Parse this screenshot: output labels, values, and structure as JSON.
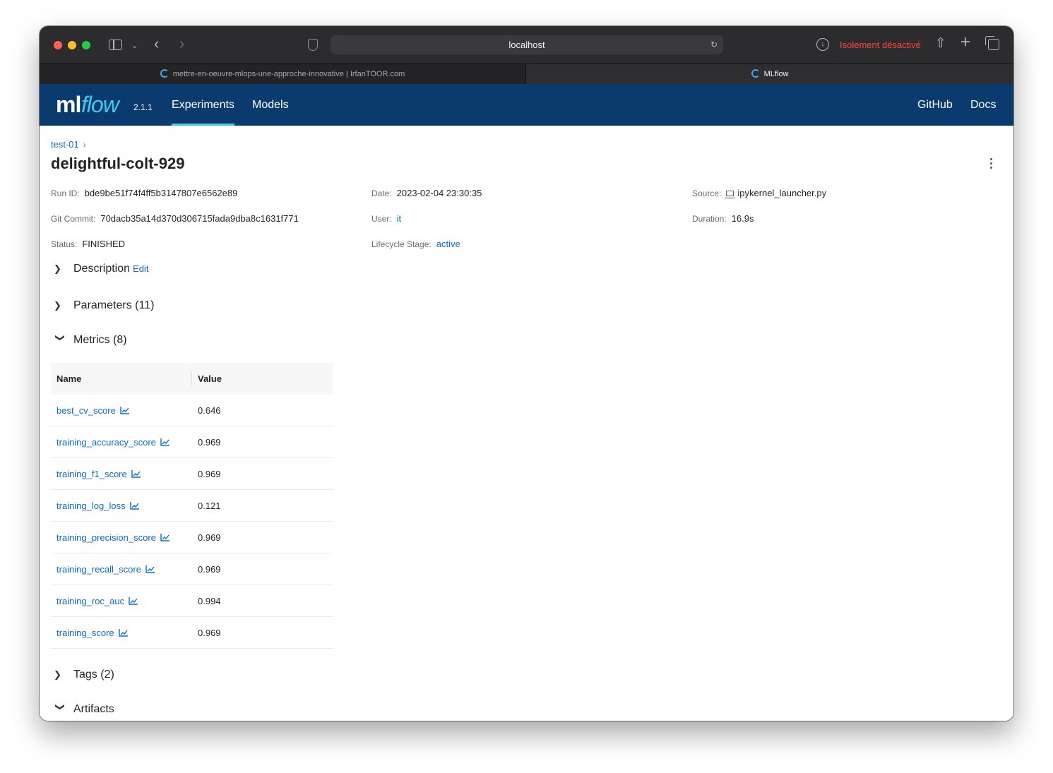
{
  "browser": {
    "url": "localhost",
    "isolation_status": "Isolement désactivé",
    "tabs": [
      {
        "label": "mettre-en-oeuvre-mlops-une-approche-innovative | IrfanTOOR.com",
        "active": false
      },
      {
        "label": "MLflow",
        "active": true
      }
    ]
  },
  "header": {
    "logo_ml": "ml",
    "logo_flow": "flow",
    "version": "2.1.1",
    "nav": {
      "experiments": "Experiments",
      "models": "Models",
      "github": "GitHub",
      "docs": "Docs"
    },
    "colors": {
      "background": "#0b3b6e",
      "accent": "#43c9ed"
    }
  },
  "run": {
    "breadcrumb": "test-01",
    "breadcrumb_sep": "›",
    "title": "delightful-colt-929",
    "fields": {
      "run_id": {
        "label": "Run ID:",
        "value": "bde9be51f74f4ff5b3147807e6562e89"
      },
      "date": {
        "label": "Date:",
        "value": "2023-02-04 23:30:35"
      },
      "source": {
        "label": "Source:",
        "value": "ipykernel_launcher.py"
      },
      "git_commit": {
        "label": "Git Commit:",
        "value": "70dacb35a14d370d306715fada9dba8c1631f771"
      },
      "user": {
        "label": "User:",
        "value": "it"
      },
      "duration": {
        "label": "Duration:",
        "value": "16.9s"
      },
      "status": {
        "label": "Status:",
        "value": "FINISHED"
      },
      "lifecycle": {
        "label": "Lifecycle Stage:",
        "value": "active"
      }
    }
  },
  "sections": {
    "description": {
      "label": "Description",
      "edit": "Edit",
      "expanded": false
    },
    "parameters": {
      "label": "Parameters (11)",
      "expanded": false
    },
    "metrics": {
      "label": "Metrics (8)",
      "expanded": true
    },
    "tags": {
      "label": "Tags (2)",
      "expanded": false
    },
    "artifacts": {
      "label": "Artifacts",
      "expanded": true
    }
  },
  "metrics_table": {
    "headers": {
      "name": "Name",
      "value": "Value"
    },
    "rows": [
      {
        "name": "best_cv_score",
        "value": "0.646"
      },
      {
        "name": "training_accuracy_score",
        "value": "0.969"
      },
      {
        "name": "training_f1_score",
        "value": "0.969"
      },
      {
        "name": "training_log_loss",
        "value": "0.121"
      },
      {
        "name": "training_precision_score",
        "value": "0.969"
      },
      {
        "name": "training_recall_score",
        "value": "0.969"
      },
      {
        "name": "training_roc_auc",
        "value": "0.994"
      },
      {
        "name": "training_score",
        "value": "0.969"
      }
    ]
  }
}
